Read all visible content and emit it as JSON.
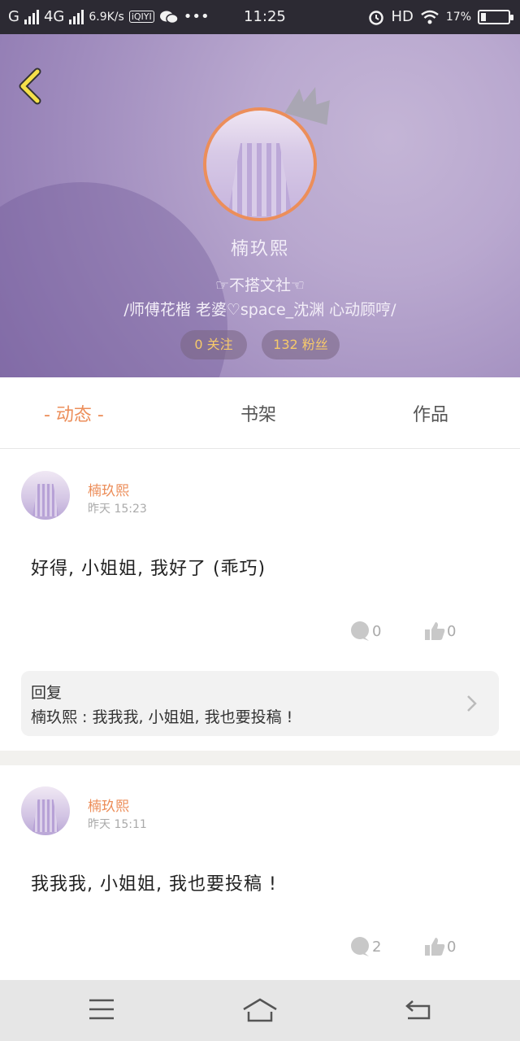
{
  "status_bar": {
    "carrier": "G",
    "network": "4G",
    "speed": "6.9K/s",
    "app_badge": "iQIYI",
    "more": "•••",
    "time": "11:25",
    "hd": "HD",
    "battery": "17%"
  },
  "profile": {
    "name": "楠玖熙",
    "group": "☞不搭文社☜",
    "bio": "/师傅花楷 老婆♡space_沈渊 心动顾哼/",
    "following": "0 关注",
    "fans": "132 粉丝"
  },
  "tabs": {
    "active": "- 动态 -",
    "shelf": "书架",
    "works": "作品"
  },
  "posts": [
    {
      "author": "楠玖熙",
      "time": "昨天 15:23",
      "content": "好得, 小姐姐, 我好了 (乖巧)",
      "comments": "0",
      "likes": "0",
      "reply_label": "回复",
      "reply_text": "楠玖熙 : 我我我, 小姐姐, 我也要投稿 !"
    },
    {
      "author": "楠玖熙",
      "time": "昨天 15:11",
      "content": "我我我, 小姐姐, 我也要投稿 !",
      "comments": "2",
      "likes": "0"
    }
  ],
  "colors": {
    "accent": "#ec8e5a",
    "header_purple": "#a996c6",
    "pill_text": "#f6c96b"
  },
  "icons": [
    "back-chevron-icon",
    "crown-icon",
    "comment-icon",
    "thumb-up-icon",
    "chevron-right-icon",
    "menu-icon",
    "home-icon",
    "back-nav-icon"
  ]
}
